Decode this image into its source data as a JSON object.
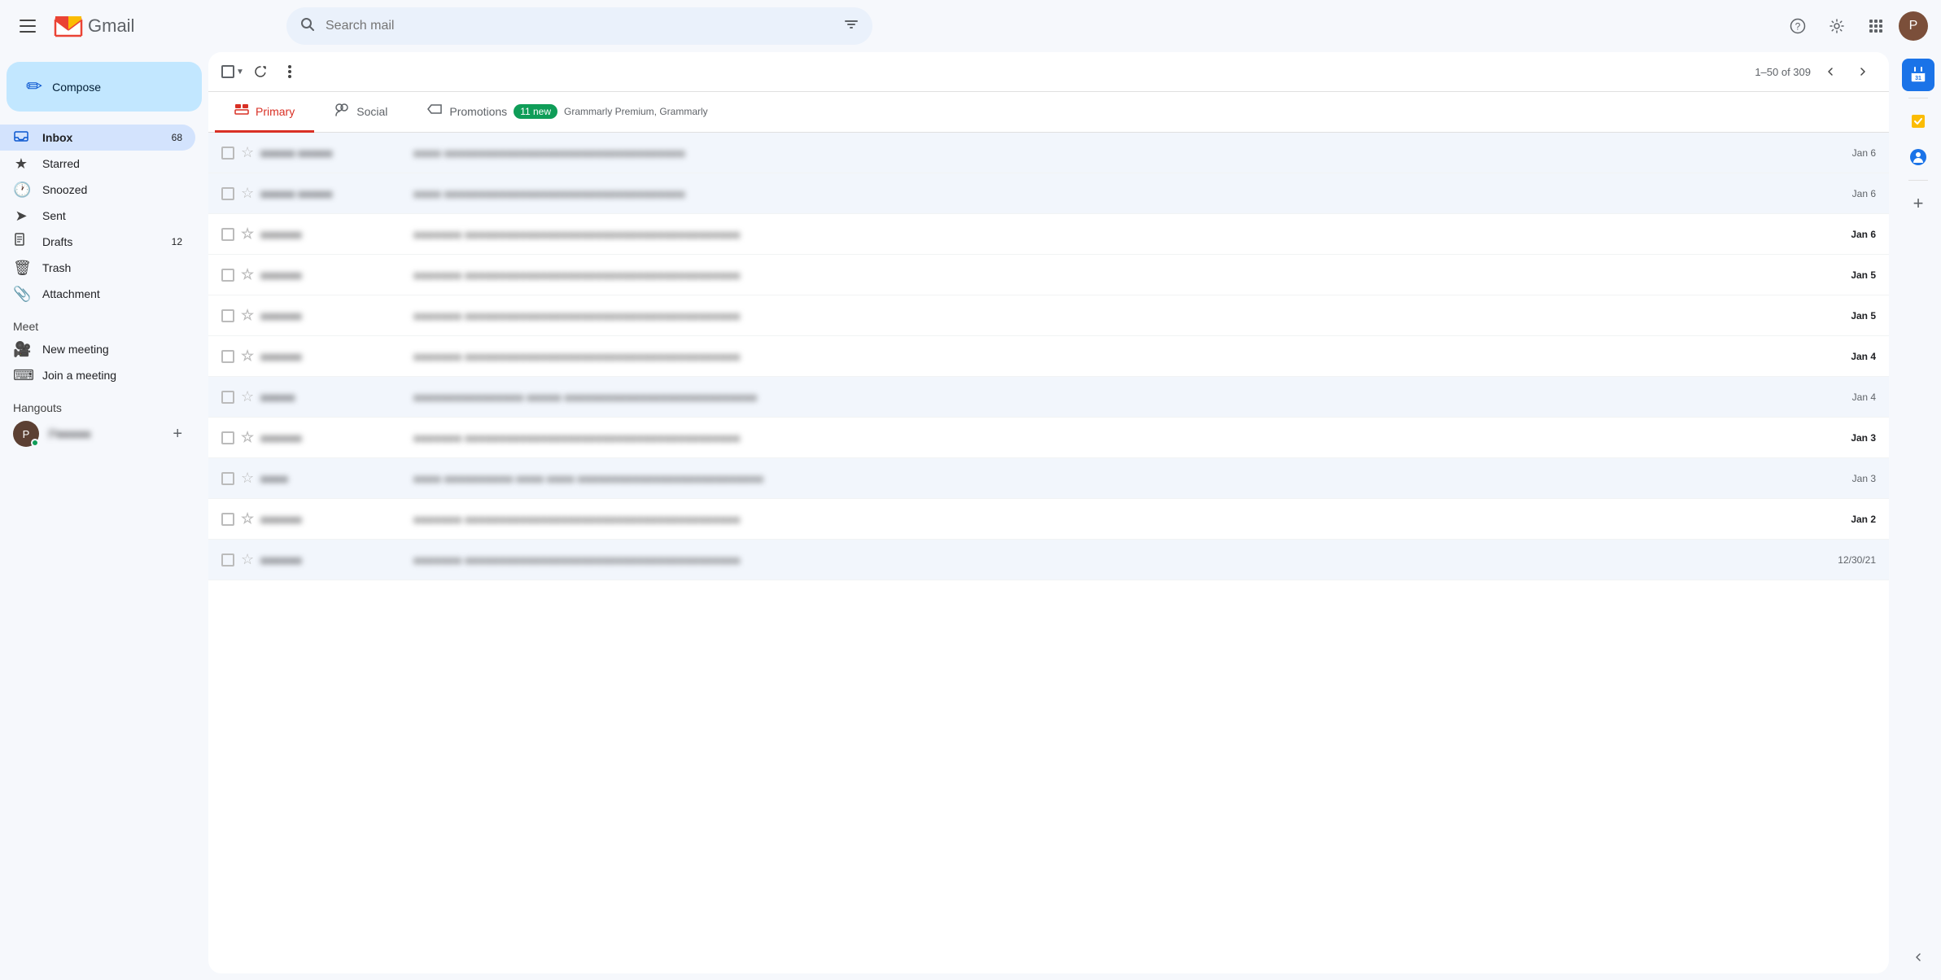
{
  "header": {
    "menu_label": "Main menu",
    "app_name": "Gmail",
    "search_placeholder": "Search mail",
    "avatar_letter": "P"
  },
  "sidebar": {
    "compose_label": "Compose",
    "nav_items": [
      {
        "id": "inbox",
        "label": "Inbox",
        "icon": "inbox",
        "badge": "68",
        "active": true
      },
      {
        "id": "starred",
        "label": "Starred",
        "icon": "star",
        "badge": "",
        "active": false
      },
      {
        "id": "snoozed",
        "label": "Snoozed",
        "icon": "clock",
        "badge": "",
        "active": false
      },
      {
        "id": "sent",
        "label": "Sent",
        "icon": "send",
        "badge": "",
        "active": false
      },
      {
        "id": "drafts",
        "label": "Drafts",
        "icon": "draft",
        "badge": "12",
        "active": false
      },
      {
        "id": "trash",
        "label": "Trash",
        "icon": "trash",
        "badge": "",
        "active": false
      },
      {
        "id": "attachment",
        "label": "Attachment",
        "icon": "attachment",
        "badge": "",
        "active": false
      }
    ],
    "meet_section": "Meet",
    "meet_items": [
      {
        "id": "new-meeting",
        "label": "New meeting",
        "icon": "video"
      },
      {
        "id": "join-meeting",
        "label": "Join a meeting",
        "icon": "keyboard"
      }
    ],
    "hangouts_section": "Hangouts",
    "hangout_user": {
      "letter": "P",
      "name": "P●●●●●"
    }
  },
  "toolbar": {
    "count_label": "1–50 of 309"
  },
  "tabs": [
    {
      "id": "primary",
      "label": "Primary",
      "icon": "inbox",
      "active": true,
      "badge": "",
      "subtitle": ""
    },
    {
      "id": "social",
      "label": "Social",
      "icon": "people",
      "active": false,
      "badge": "",
      "subtitle": ""
    },
    {
      "id": "promotions",
      "label": "Promotions",
      "icon": "tag",
      "active": false,
      "badge": "11 new",
      "subtitle": "Grammarly Premium, Grammarly"
    }
  ],
  "emails": [
    {
      "sender": "●●●●● ●●●●●",
      "subject": "●●●● ●●●●●●●●●●●●●●●●●●●●●●●●●●●●●●●●●●●",
      "date": "Jan 6",
      "unread": false
    },
    {
      "sender": "●●●●● ●●●●●",
      "subject": "●●●● ●●●●●●●●●●●●●●●●●●●●●●●●●●●●●●●●●●●",
      "date": "Jan 6",
      "unread": false
    },
    {
      "sender": "●●●●●●",
      "subject": "●●●●●●● ●●●●●●●●●●●●●●●●●●●●●●●●●●●●●●●●●●●●●●●●",
      "date": "Jan 6",
      "unread": true
    },
    {
      "sender": "●●●●●●",
      "subject": "●●●●●●● ●●●●●●●●●●●●●●●●●●●●●●●●●●●●●●●●●●●●●●●●",
      "date": "Jan 5",
      "unread": true
    },
    {
      "sender": "●●●●●●",
      "subject": "●●●●●●● ●●●●●●●●●●●●●●●●●●●●●●●●●●●●●●●●●●●●●●●●",
      "date": "Jan 5",
      "unread": true
    },
    {
      "sender": "●●●●●●",
      "subject": "●●●●●●● ●●●●●●●●●●●●●●●●●●●●●●●●●●●●●●●●●●●●●●●●",
      "date": "Jan 4",
      "unread": true
    },
    {
      "sender": "●●●●●",
      "subject": "●●●●●●●●●●●●●●●● ●●●●● ●●●●●●●●●●●●●●●●●●●●●●●●●●●●",
      "date": "Jan 4",
      "unread": false
    },
    {
      "sender": "●●●●●●",
      "subject": "●●●●●●● ●●●●●●●●●●●●●●●●●●●●●●●●●●●●●●●●●●●●●●●●",
      "date": "Jan 3",
      "unread": true
    },
    {
      "sender": "●●●●",
      "subject": "●●●● ●●●●●●●●●● ●●●● ●●●● ●●●●●●●●●●●●●●●●●●●●●●●●●●●",
      "date": "Jan 3",
      "unread": false
    },
    {
      "sender": "●●●●●●",
      "subject": "●●●●●●● ●●●●●●●●●●●●●●●●●●●●●●●●●●●●●●●●●●●●●●●●",
      "date": "Jan 2",
      "unread": true
    },
    {
      "sender": "●●●●●●",
      "subject": "●●●●●●● ●●●●●●●●●●●●●●●●●●●●●●●●●●●●●●●●●●●●●●●●",
      "date": "12/30/21",
      "unread": false
    }
  ],
  "right_sidebar": {
    "icons": [
      {
        "id": "calendar",
        "symbol": "📅"
      },
      {
        "id": "tasks",
        "symbol": "✔"
      },
      {
        "id": "contacts",
        "symbol": "👤"
      }
    ]
  }
}
